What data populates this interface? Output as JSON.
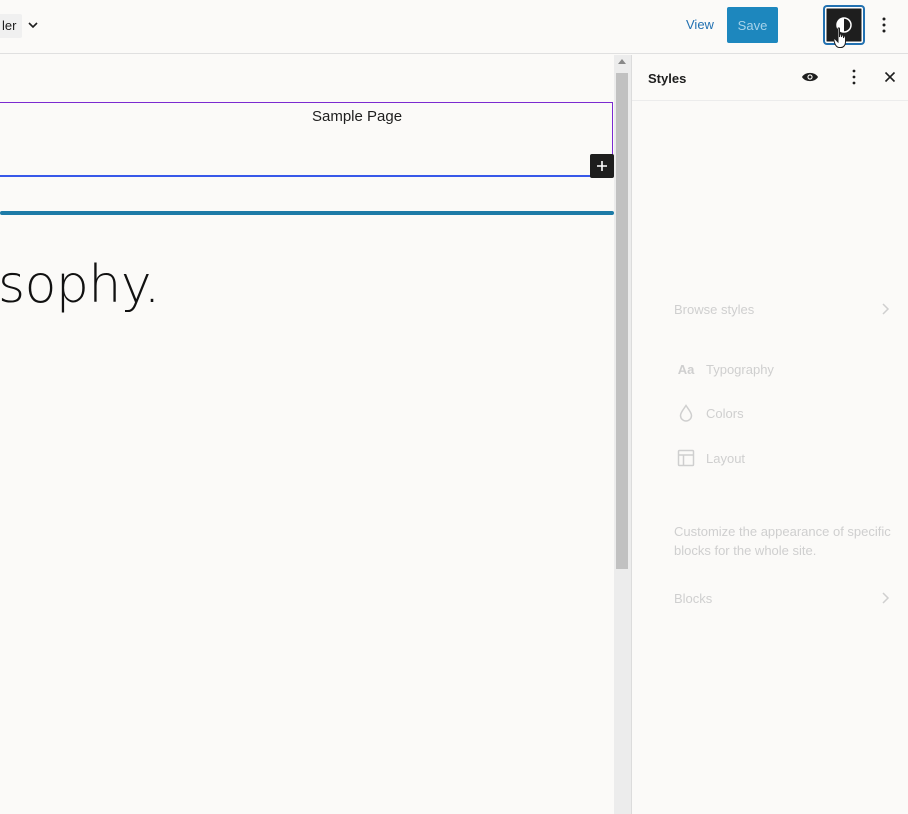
{
  "topbar": {
    "template_label": "ler",
    "view_label": "View",
    "save_label": "Save"
  },
  "canvas": {
    "nav_item": "Sample Page",
    "heading_fragment": "sophy."
  },
  "sidebar": {
    "title": "Styles",
    "browse_styles": "Browse styles",
    "items": [
      {
        "label": "Typography",
        "icon": "typography-icon",
        "glyph": "Aa"
      },
      {
        "label": "Colors",
        "icon": "droplet-icon"
      },
      {
        "label": "Layout",
        "icon": "layout-icon"
      }
    ],
    "description": "Customize the appearance of specific blocks for the whole site.",
    "blocks": "Blocks"
  },
  "colors": {
    "accent": "#2271b1",
    "save_bg": "#1d87be",
    "selection_outline": "#7b2bd0"
  }
}
